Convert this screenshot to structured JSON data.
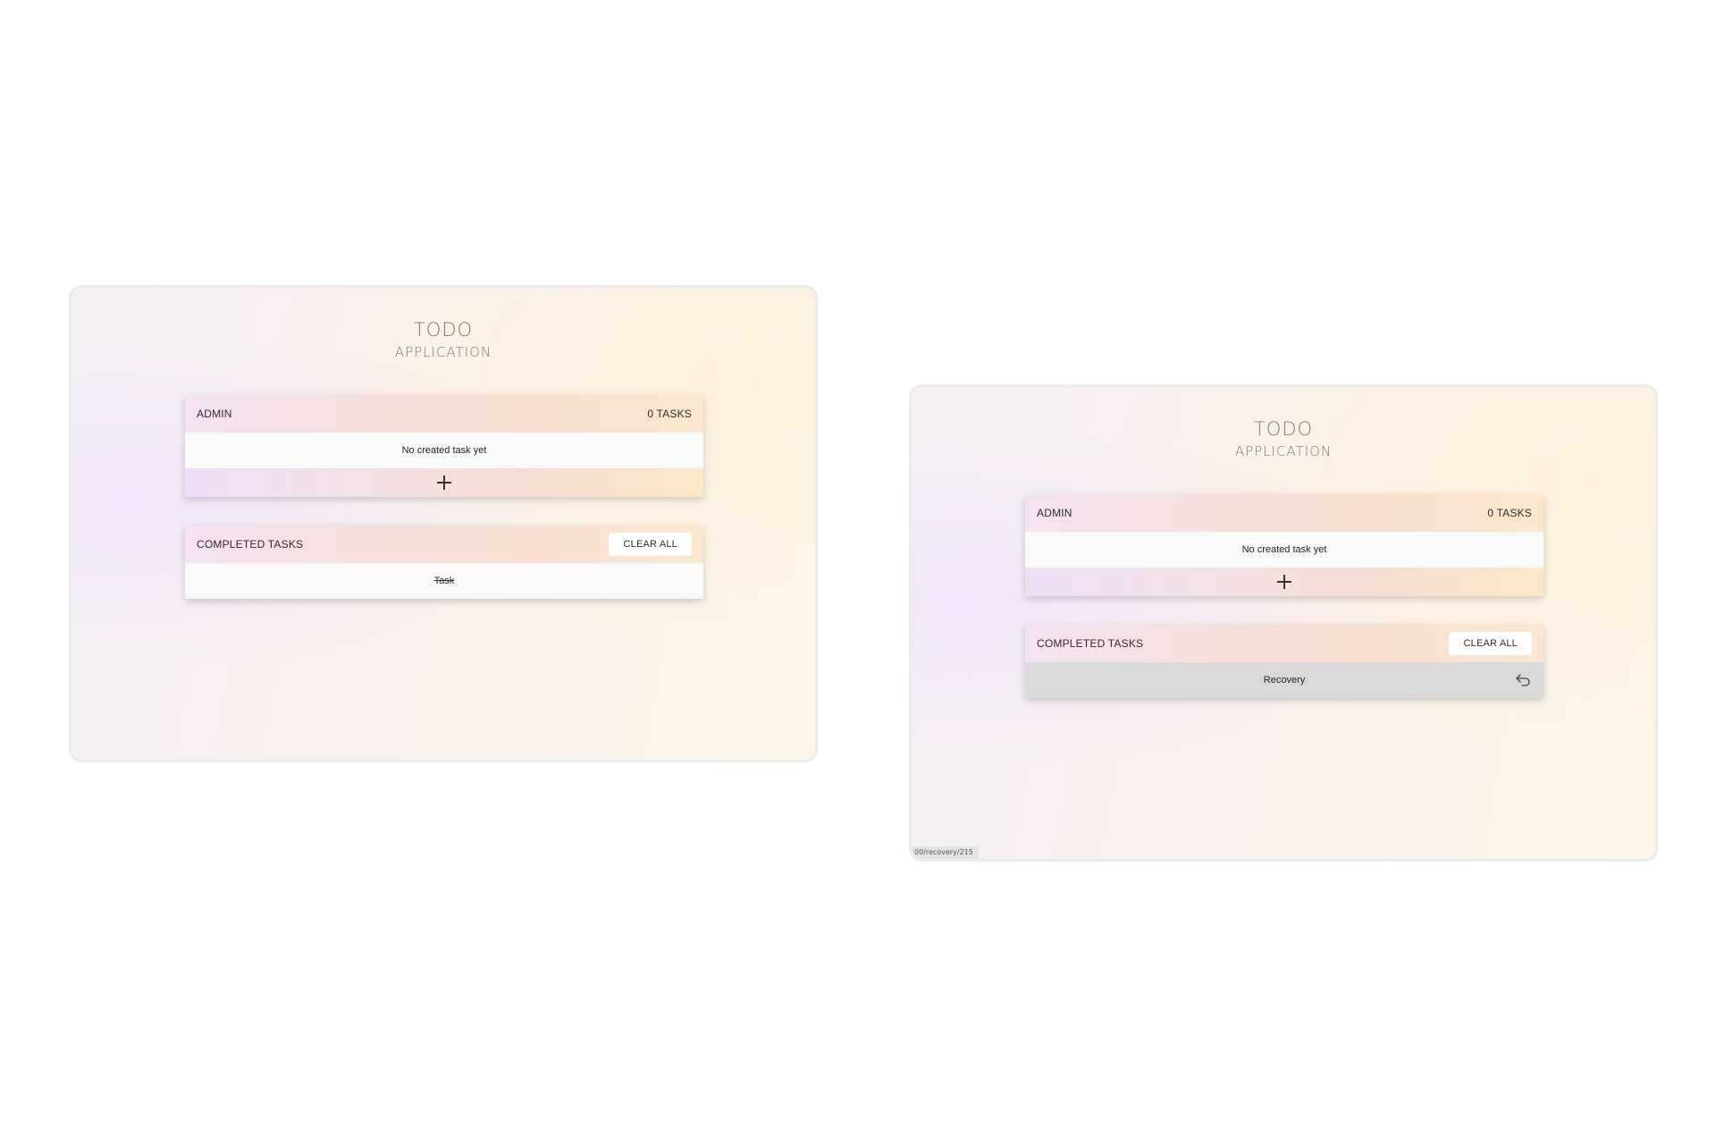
{
  "left_panel": {
    "title_line1": "TODO",
    "title_line2": "APPLICATION",
    "tasks_card": {
      "user_label": "ADMIN",
      "task_count": "0 TASKS",
      "empty_message": "No created task yet"
    },
    "completed_card": {
      "heading": "COMPLETED TASKS",
      "clear_label": "CLEAR ALL",
      "items": [
        "Task"
      ]
    }
  },
  "right_panel": {
    "title_line1": "TODO",
    "title_line2": "APPLICATION",
    "tasks_card": {
      "user_label": "ADMIN",
      "task_count": "0 TASKS",
      "empty_message": "No created task yet"
    },
    "completed_card": {
      "heading": "COMPLETED TASKS",
      "clear_label": "CLEAR ALL",
      "hover_label": "Recovery"
    },
    "status_url": "00/recovery/215"
  },
  "icons": {
    "add": "plus-icon",
    "recover": "undo-icon"
  },
  "colors": {
    "recovery_row": "#d9d9d9",
    "header_gradient_start": "#f4e2f2",
    "header_gradient_end": "#fbe7cf"
  }
}
